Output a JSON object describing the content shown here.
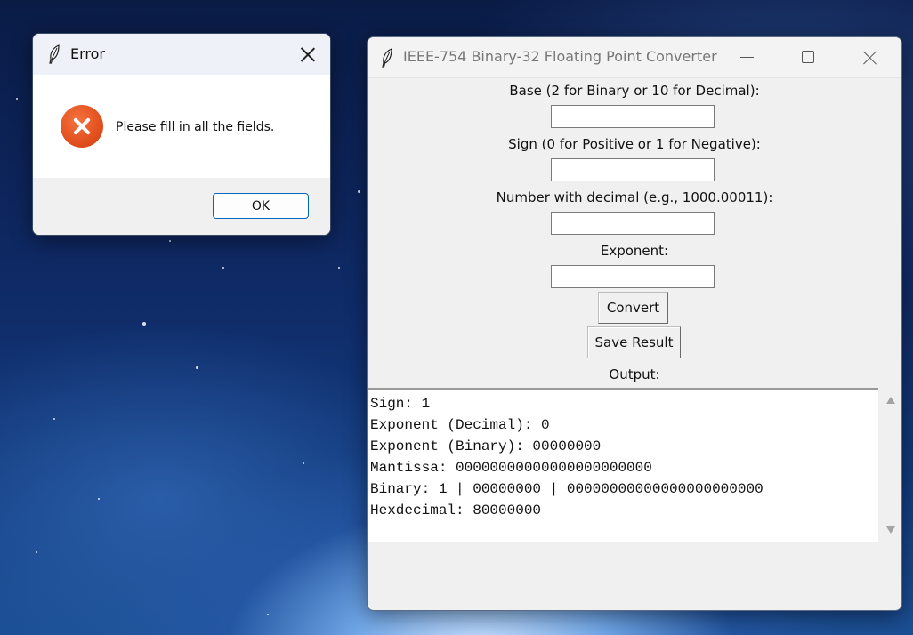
{
  "error_dialog": {
    "title": "Error",
    "message": "Please fill in all the fields.",
    "ok_label": "OK",
    "icon": "error-x-icon",
    "icon_color": "#e2501f"
  },
  "window": {
    "title": "IEEE-754 Binary-32 Floating Point Converter",
    "icon": "feather-icon"
  },
  "form": {
    "base_label": "Base (2 for Binary or 10 for Decimal):",
    "base_value": "",
    "sign_label": "Sign (0 for Positive or 1 for Negative):",
    "sign_value": "",
    "number_label": "Number with decimal (e.g., 1000.00011):",
    "number_value": "",
    "exponent_label": "Exponent:",
    "exponent_value": "",
    "convert_label": "Convert",
    "save_label": "Save Result",
    "output_label": "Output:"
  },
  "output": {
    "lines": [
      "Sign: 1",
      "Exponent (Decimal): 0",
      "Exponent (Binary): 00000000",
      "Mantissa: 00000000000000000000000",
      "Binary: 1 | 00000000 | 00000000000000000000000",
      "Hexdecimal: 80000000"
    ]
  },
  "colors": {
    "accent": "#0067c0",
    "window_bg": "#f0f0f0"
  }
}
